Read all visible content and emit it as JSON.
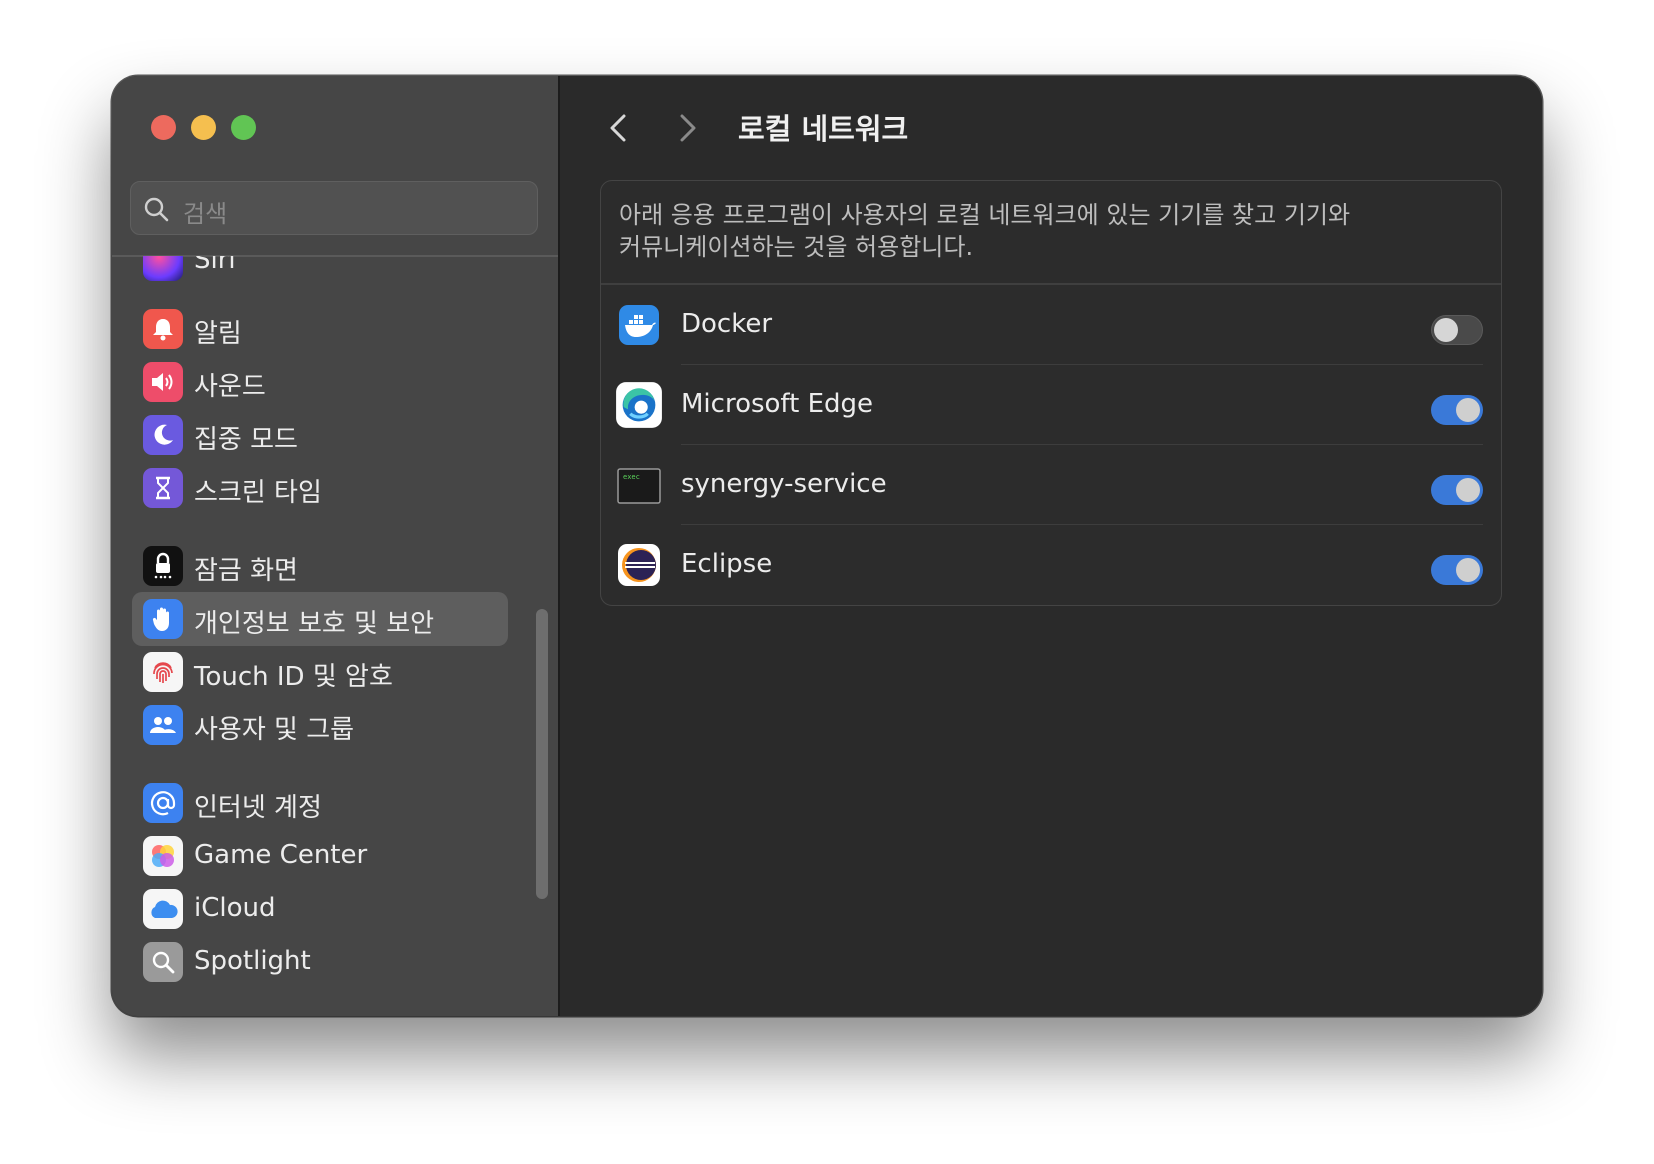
{
  "window": {
    "traffic_lights": [
      "close",
      "minimize",
      "maximize"
    ]
  },
  "sidebar": {
    "search_placeholder": "검색",
    "items": [
      {
        "label": "Siri",
        "icon": "siri-icon",
        "color": "#7a3cff"
      },
      {
        "label": "알림",
        "icon": "bell-icon",
        "color": "#f0574d"
      },
      {
        "label": "사운드",
        "icon": "speaker-icon",
        "color": "#ee4d6a"
      },
      {
        "label": "집중 모드",
        "icon": "moon-icon",
        "color": "#6a5ae0"
      },
      {
        "label": "스크린 타임",
        "icon": "hourglass-icon",
        "color": "#7458d8"
      },
      {
        "label": "잠금 화면",
        "icon": "lock-icon",
        "color": "#111111"
      },
      {
        "label": "개인정보 보호 및 보안",
        "icon": "hand-icon",
        "color": "#3d82f0",
        "selected": true
      },
      {
        "label": "Touch ID 및 암호",
        "icon": "fingerprint-icon",
        "color": "#f6f6f6"
      },
      {
        "label": "사용자 및 그룹",
        "icon": "users-icon",
        "color": "#3d82f0"
      },
      {
        "label": "인터넷 계정",
        "icon": "at-icon",
        "color": "#3d82f0"
      },
      {
        "label": "Game Center",
        "icon": "game-center-icon",
        "color": "#f6f6f6"
      },
      {
        "label": "iCloud",
        "icon": "cloud-icon",
        "color": "#f6f6f6"
      },
      {
        "label": "Spotlight",
        "icon": "magnifier-icon",
        "color": "#9a9a9a"
      }
    ]
  },
  "main": {
    "title": "로컬 네트워크",
    "description": "아래 응용 프로그램이 사용자의 로컬 네트워크에 있는 기기를 찾고 기기와 커뮤니케이션하는 것을 허용합니다.",
    "apps": [
      {
        "name": "Docker",
        "icon": "docker-icon",
        "enabled": false
      },
      {
        "name": "Microsoft Edge",
        "icon": "edge-icon",
        "enabled": true
      },
      {
        "name": "synergy-service",
        "icon": "terminal-exec-icon",
        "enabled": true,
        "icon_text": "exec"
      },
      {
        "name": "Eclipse",
        "icon": "eclipse-icon",
        "enabled": true
      }
    ]
  },
  "colors": {
    "accent": "#3a79d8",
    "sidebar_bg": "#464646",
    "main_bg": "#2a2a2a"
  }
}
